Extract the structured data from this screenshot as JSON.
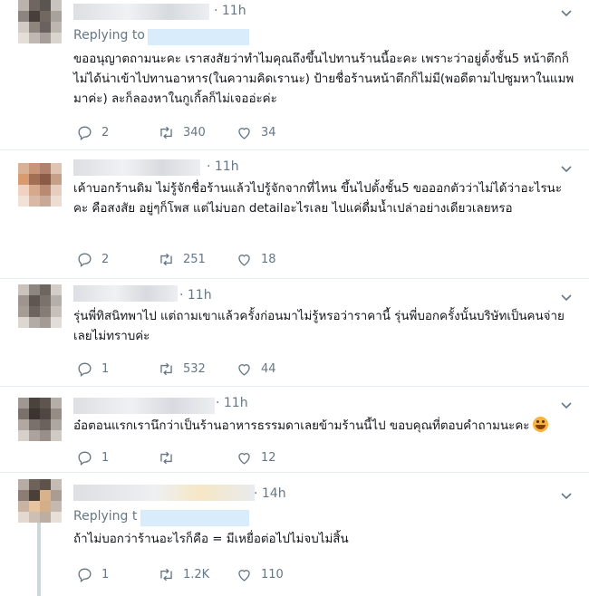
{
  "replying_label": "Replying to",
  "replying_label_short": "Replying t",
  "tweets": [
    {
      "time": "· 11h",
      "text": "ขออนุญาตถามนะคะ เราสงสัยว่าทำไมคุณถึงขึ้นไปทานร้านนี้อะคะ เพราะว่าอยู่ตั้งชั้น5 หน้าตึกก็ไม่ได้น่าเข้าไปทานอาหาร(ในความคิดเรานะ) ป้ายชื่อร้านหน้าตึกก็ไม่มี(พอดีตามไปซูมหาในแมพมาค่ะ) ละก็ลองหาในกูเกิ้ลก็ไม่เจออ่ะค่ะ",
      "replies": "2",
      "retweets": "340",
      "likes": "34"
    },
    {
      "time": "· 11h",
      "text": "เค้าบอกร้านดิม ไม่รู้จักชื่อร้านแล้วไปรู้จักจากที่ไหน ขึ้นไปตั้งชั้น5 ขอออกตัวว่าไม่ได้ว่าอะไรนะคะ คือสงสัย อยู่ๆก็โพส แต่ไม่บอก detailอะไรเลย ไปแค่ดื่มน้ำเปล่าอย่างเดียวเลยหรอ",
      "replies": "2",
      "retweets": "251",
      "likes": "18"
    },
    {
      "time": "· 11h",
      "text": "รุ่นพี่ทิสนิทพาไป แต่ถามเขาแล้วครั้งก่อนมาไม่รู้หรอว่าราคานี้ รุ่นพี่บอกครั้งนั้นบริษัทเป็นคนจ่ายเลยไม่ทราบค่ะ",
      "replies": "1",
      "retweets": "532",
      "likes": "44"
    },
    {
      "time": "· 11h",
      "text": "อ๋อตอนแรกเรานึกว่าเป็นร้านอาหารธรรมดาเลยข้ามร้านนี้ไป ขอบคุณที่ตอบคำถามนะคะ",
      "replies": "1",
      "retweets": "",
      "likes": "12"
    },
    {
      "time": "· 14h",
      "text": "ถ้าไม่บอกว่าร้านอะไรก็คือ = มีเหยื่อต่อไปไม่จบไม่สิ้น",
      "replies": "1",
      "retweets": "1.2K",
      "likes": "110"
    }
  ],
  "colors": {
    "muted": "#657786",
    "text": "#14171a",
    "border": "#e6ecf0",
    "link": "#1da1f2"
  },
  "icons": [
    "reply-icon",
    "retweet-icon",
    "like-icon",
    "caret-down-icon",
    "smile-emoji-icon"
  ]
}
